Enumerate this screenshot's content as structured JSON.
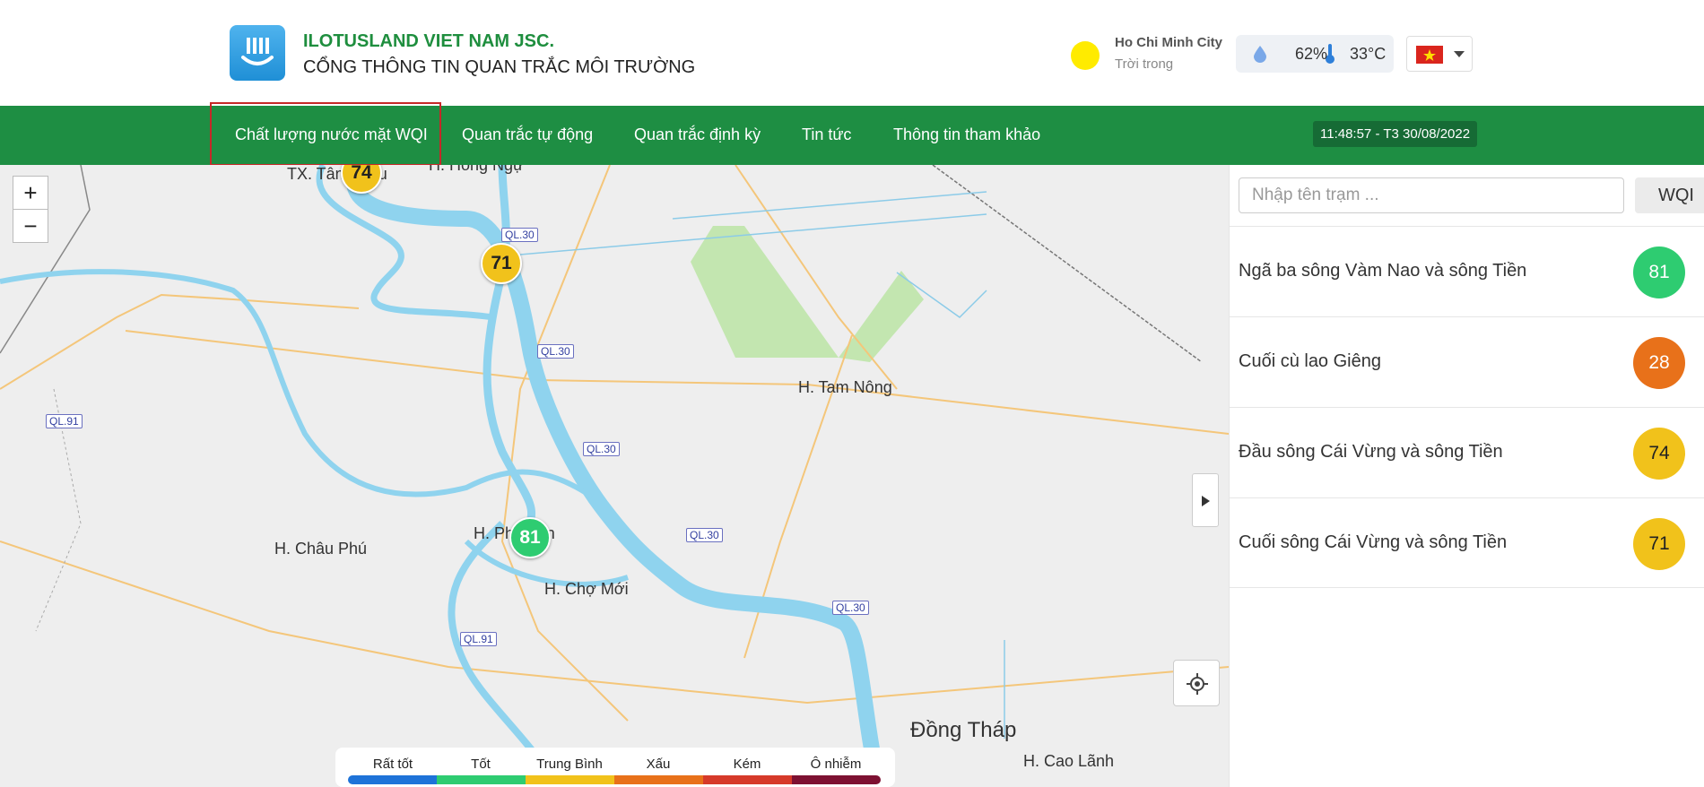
{
  "header": {
    "company": "ILOTUSLAND VIET NAM JSC.",
    "portal_title": "CỔNG THÔNG TIN QUAN TRẮC MÔI TRƯỜNG",
    "weather": {
      "city": "Ho Chi Minh City",
      "condition": "Trời trong",
      "humidity": "62%",
      "temperature": "33°C"
    },
    "language_icon": "vietnam-flag-icon"
  },
  "nav": {
    "items": [
      "Chất lượng nước mặt WQI",
      "Quan trắc tự động",
      "Quan trắc định kỳ",
      "Tin tức",
      "Thông tin tham khảo"
    ],
    "active_index": 0,
    "clock": "11:48:57 - T3 30/08/2022"
  },
  "map": {
    "zoom_in": "+",
    "zoom_out": "−",
    "markers": [
      {
        "value": "74",
        "color": "#f1c21b"
      },
      {
        "value": "71",
        "color": "#f1c21b"
      },
      {
        "value": "81",
        "color": "#2ecc71"
      }
    ],
    "places": [
      "TX. Tân Châu",
      "H. Hồng Ngự",
      "H. Tam Nông",
      "H. Châu Phú",
      "H. Phú Tân",
      "H. Chợ Mới",
      "Đồng Tháp",
      "H. Cao Lãnh"
    ],
    "roads": [
      "QL.30",
      "QL.30",
      "QL.91",
      "QL.30",
      "QL.30",
      "QL.30",
      "QL.91"
    ]
  },
  "legend": [
    {
      "label": "Rất tốt",
      "color": "#1e73d8"
    },
    {
      "label": "Tốt",
      "color": "#2ecc71"
    },
    {
      "label": "Trung Bình",
      "color": "#f1c21b"
    },
    {
      "label": "Xấu",
      "color": "#e8711a"
    },
    {
      "label": "Kém",
      "color": "#d63a2a"
    },
    {
      "label": "Ô nhiễm",
      "color": "#7d1132"
    }
  ],
  "panel": {
    "search_placeholder": "Nhập tên trạm ...",
    "sort_label": "WQI",
    "stations": [
      {
        "name": "Ngã ba sông Vàm Nao và sông Tiền",
        "wqi": "81",
        "color": "#2ecc71"
      },
      {
        "name": "Cuối cù lao Giêng",
        "wqi": "28",
        "color": "#e8711a"
      },
      {
        "name": "Đầu sông Cái Vừng và sông Tiền",
        "wqi": "74",
        "color": "#f1c21b"
      },
      {
        "name": "Cuối sông Cái Vừng và sông Tiền",
        "wqi": "71",
        "color": "#f1c21b"
      }
    ]
  }
}
